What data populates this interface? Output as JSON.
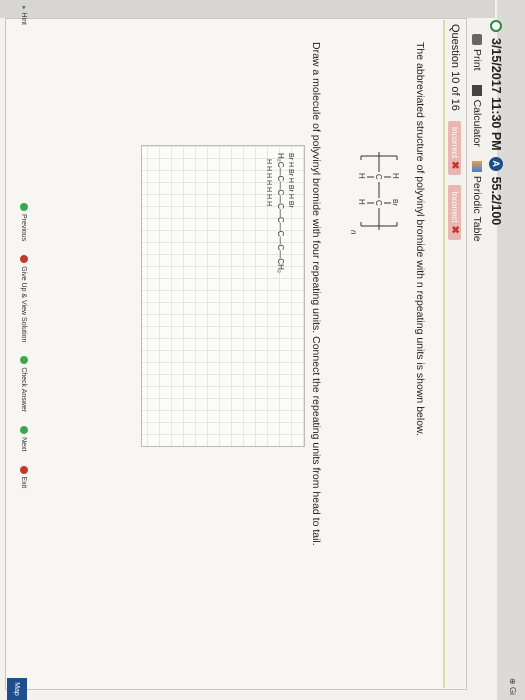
{
  "header": {
    "timestamp": "3/15/2017 11:30 PM",
    "score": "55.2/100"
  },
  "toolbar": {
    "print": "Print",
    "calculator": "Calculator",
    "periodic_table": "Periodic Table"
  },
  "question": {
    "label": "Question 10 of 16",
    "attempts": [
      "Incorrect",
      "Incorrect"
    ],
    "prompt1": "The abbreviated structure of polyvinyl bromide with n repeating units is shown below.",
    "prompt2": "Draw a molecule of polyvinyl bromide with four repeating units. Connect the repeating units from head to tail."
  },
  "structure": {
    "h": "H",
    "br": "Br",
    "c": "C",
    "n": "n"
  },
  "drawing": {
    "top_row": "Br    H    Br    H    Br    H    Br",
    "mid_row": "H₂C—C—C—C—C—C—C—CH₂",
    "bot_row": "H   H    H   H    H   H    H"
  },
  "footer": {
    "previous": "Previous",
    "give_up": "Give Up & View Solution",
    "check": "Check Answer",
    "next": "Next",
    "exit": "Exit",
    "hint": "Hint"
  },
  "side": {
    "map": "Map",
    "help": "Gi"
  }
}
